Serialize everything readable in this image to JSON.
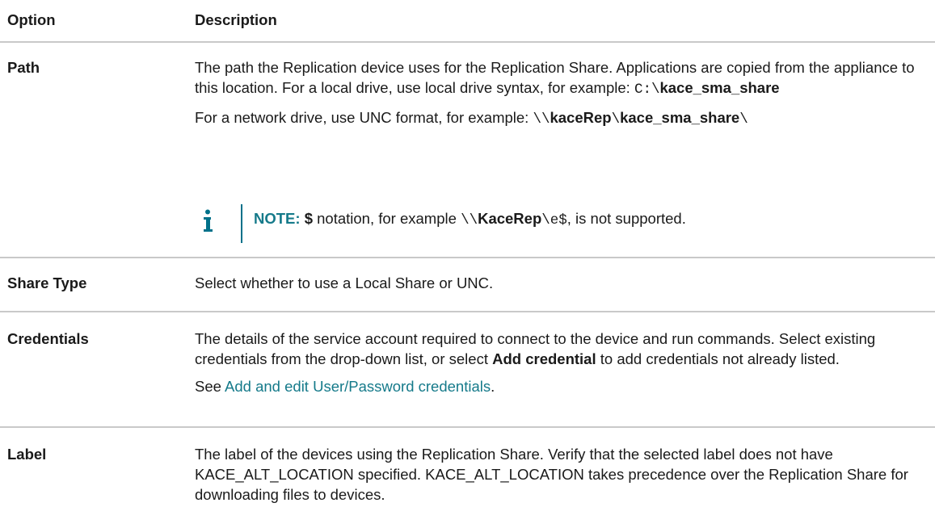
{
  "header": {
    "col_option": "Option",
    "col_description": "Description"
  },
  "rows": {
    "path": {
      "option": "Path",
      "p1_text": "The path the Replication device uses for the Replication Share. Applications are copied from the appliance to this location. For a local drive, use local drive syntax, for example: ",
      "p1_code": "C:\\",
      "p1_bold": "kace_sma_share",
      "p2_text": "For a network drive, use UNC format, for example: ",
      "p2_code1": "\\\\",
      "p2_bold1": "kaceRep",
      "p2_code2": "\\",
      "p2_bold2": "kace_sma_share",
      "p2_code3": "\\",
      "note_label": "NOTE:",
      "note_bold": "$",
      "note_text1": " notation, for example ",
      "note_code1": "\\\\",
      "note_bold2": "KaceRep",
      "note_code2": "\\e$",
      "note_text2": ", is not supported.",
      "note_icon": "info-icon"
    },
    "share_type": {
      "option": "Share Type",
      "text": "Select whether to use a Local Share or UNC."
    },
    "credentials": {
      "option": "Credentials",
      "p1_text": "The details of the service account required to connect to the device and run commands. Select existing credentials from the drop-down list, or select ",
      "p1_bold": "Add credential",
      "p1_text2": " to add credentials not already listed.",
      "p2_text": "See ",
      "p2_link": "Add and edit User/Password credentials",
      "p2_text2": "."
    },
    "label": {
      "option": "Label",
      "text": "The label of the devices using the Replication Share. Verify that the selected label does not have KACE_ALT_LOCATION specified. KACE_ALT_LOCATION takes precedence over the Replication Share for downloading files to devices."
    }
  },
  "colors": {
    "link": "#157a8a",
    "note_accent": "#00718a",
    "rule": "#c9c9c9"
  }
}
